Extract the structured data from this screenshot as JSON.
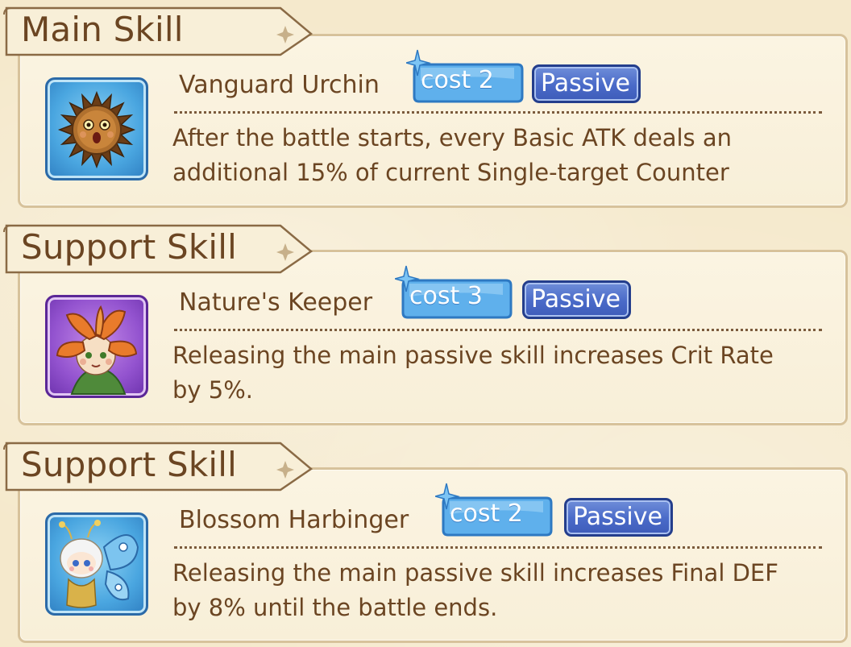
{
  "sections": [
    {
      "header": "Main Skill",
      "skill_name": "Vanguard Urchin",
      "cost": "cost 2",
      "type": "Passive",
      "icon": "urchin-icon",
      "description": "After the battle starts, every Basic ATK deals an additional 15% of current Single-target Counter"
    },
    {
      "header": "Support Skill",
      "skill_name": "Nature's Keeper",
      "cost": "cost 3",
      "type": "Passive",
      "icon": "flower-keeper-icon",
      "description": "Releasing the main passive skill increases Crit Rate by 5%."
    },
    {
      "header": "Support Skill",
      "skill_name": "Blossom Harbinger",
      "cost": "cost 2",
      "type": "Passive",
      "icon": "butterfly-fairy-icon",
      "description": "Releasing the main passive skill increases Final DEF by 8% until the battle ends."
    }
  ],
  "colors": {
    "text_brown": "#6b4522",
    "panel_bg": "#f8efd8",
    "panel_border": "#d7c29b",
    "cost_badge": "#5fb0ec",
    "passive_badge": "#4a6ac8"
  }
}
